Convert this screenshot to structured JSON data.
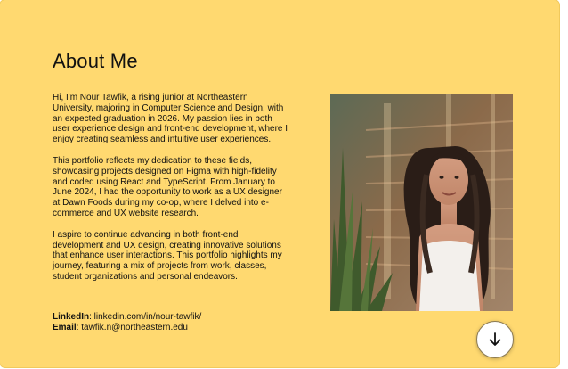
{
  "about": {
    "title": "About Me",
    "paragraphs": [
      "Hi, I'm Nour Tawfik, a rising junior at Northeastern\nUniversity, majoring in Computer Science and Design, with\nan expected graduation in 2026. My passion lies in both\nuser experience design and front-end development, where I\nenjoy creating seamless and intuitive user experiences.",
      "This portfolio reflects my dedication to these fields,\nshowcasing projects designed on Figma with high-fidelity\nand coded using React and TypeScript. From January to\nJune 2024, I had the opportunity to work as a UX designer\nat Dawn Foods during my co-op, where I delved into e-\ncommerce and UX website research.",
      "I aspire to continue advancing in both front-end\ndevelopment and UX design, creating innovative solutions\nthat enhance user interactions. This portfolio highlights my\njourney, featuring a mix of projects from work, classes,\nstudent organizations and personal endeavors."
    ],
    "contact": {
      "linkedin_label": "LinkedIn",
      "linkedin_value": ": linkedin.com/in/nour-tawfik/",
      "email_label": "Email",
      "email_value": ": tawfik.n@northeastern.edu"
    }
  },
  "scroll_button": {
    "icon": "arrow-down-icon"
  },
  "colors": {
    "background": "#ffd970",
    "text": "#111111",
    "button": "#ffffff"
  }
}
